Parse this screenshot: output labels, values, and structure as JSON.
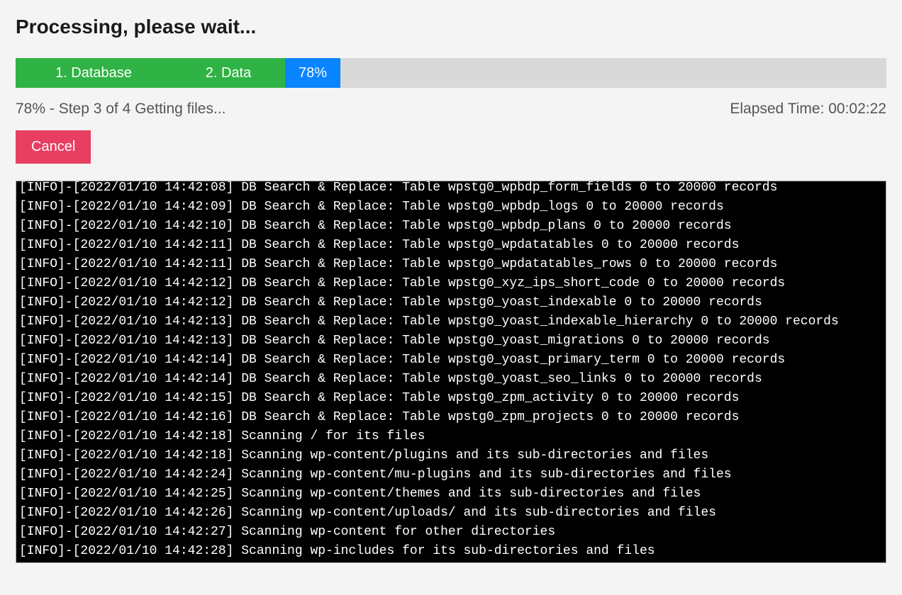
{
  "title": "Processing, please wait...",
  "progress": {
    "segments": [
      {
        "label": "1. Database"
      },
      {
        "label": "2. Data"
      }
    ],
    "percent_label": "78%"
  },
  "status_left": "78% - Step 3 of 4 Getting files...",
  "status_right": "Elapsed Time: 00:02:22",
  "cancel_label": "Cancel",
  "log_lines": [
    "[INFO]-[2022/01/10 14:42:08] DB Search & Replace: Table wpstg0_wpbdp_form_fields 0 to 20000 records",
    "[INFO]-[2022/01/10 14:42:09] DB Search & Replace: Table wpstg0_wpbdp_logs 0 to 20000 records",
    "[INFO]-[2022/01/10 14:42:10] DB Search & Replace: Table wpstg0_wpbdp_plans 0 to 20000 records",
    "[INFO]-[2022/01/10 14:42:11] DB Search & Replace: Table wpstg0_wpdatatables 0 to 20000 records",
    "[INFO]-[2022/01/10 14:42:11] DB Search & Replace: Table wpstg0_wpdatatables_rows 0 to 20000 records",
    "[INFO]-[2022/01/10 14:42:12] DB Search & Replace: Table wpstg0_xyz_ips_short_code 0 to 20000 records",
    "[INFO]-[2022/01/10 14:42:12] DB Search & Replace: Table wpstg0_yoast_indexable 0 to 20000 records",
    "[INFO]-[2022/01/10 14:42:13] DB Search & Replace: Table wpstg0_yoast_indexable_hierarchy 0 to 20000 records",
    "[INFO]-[2022/01/10 14:42:13] DB Search & Replace: Table wpstg0_yoast_migrations 0 to 20000 records",
    "[INFO]-[2022/01/10 14:42:14] DB Search & Replace: Table wpstg0_yoast_primary_term 0 to 20000 records",
    "[INFO]-[2022/01/10 14:42:14] DB Search & Replace: Table wpstg0_yoast_seo_links 0 to 20000 records",
    "[INFO]-[2022/01/10 14:42:15] DB Search & Replace: Table wpstg0_zpm_activity 0 to 20000 records",
    "[INFO]-[2022/01/10 14:42:16] DB Search & Replace: Table wpstg0_zpm_projects 0 to 20000 records",
    "[INFO]-[2022/01/10 14:42:18] Scanning / for its files",
    "[INFO]-[2022/01/10 14:42:18] Scanning wp-content/plugins and its sub-directories and files",
    "[INFO]-[2022/01/10 14:42:24] Scanning wp-content/mu-plugins and its sub-directories and files",
    "[INFO]-[2022/01/10 14:42:25] Scanning wp-content/themes and its sub-directories and files",
    "[INFO]-[2022/01/10 14:42:26] Scanning wp-content/uploads/ and its sub-directories and files",
    "[INFO]-[2022/01/10 14:42:27] Scanning wp-content for other directories",
    "[INFO]-[2022/01/10 14:42:28] Scanning wp-includes for its sub-directories and files"
  ]
}
